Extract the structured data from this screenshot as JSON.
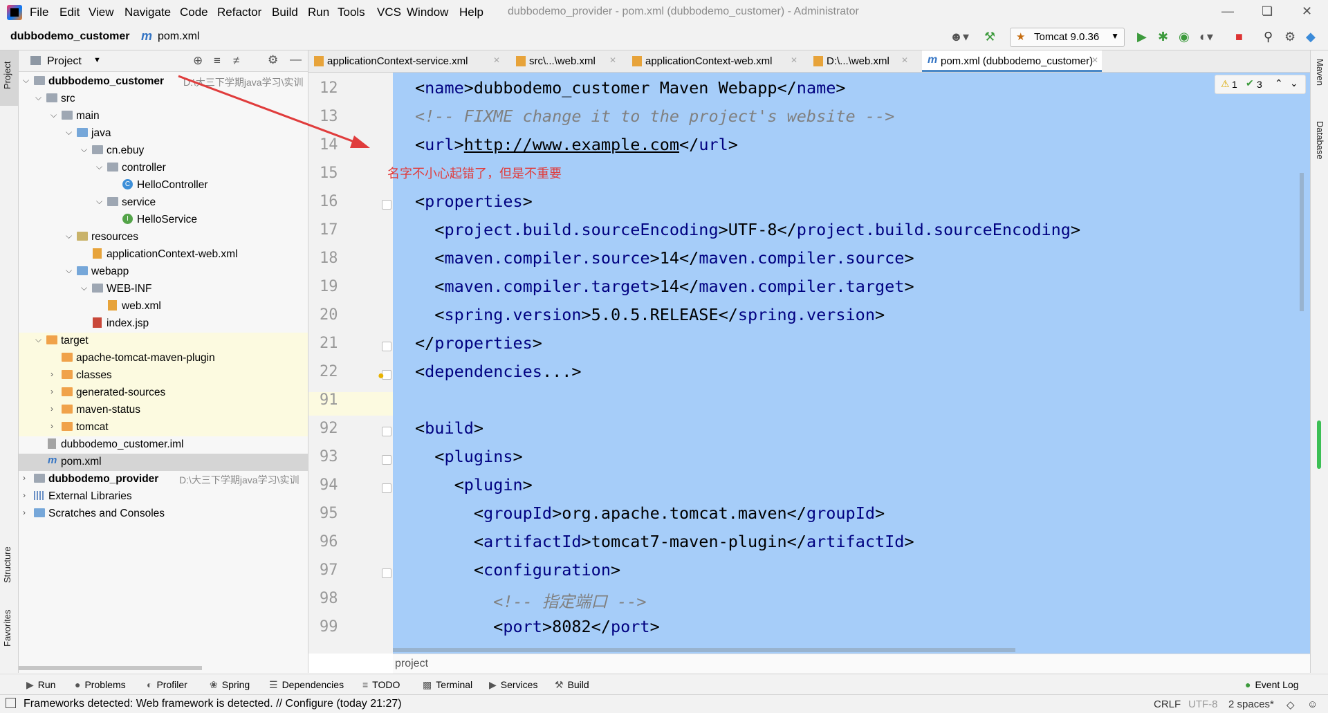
{
  "menubar": {
    "items": [
      "File",
      "Edit",
      "View",
      "Navigate",
      "Code",
      "Refactor",
      "Build",
      "Run",
      "Tools",
      "VCS",
      "Window",
      "Help"
    ],
    "window_title": "dubbodemo_provider - pom.xml (dubbodemo_customer) - Administrator"
  },
  "navbar": {
    "project": "dubbodemo_customer",
    "file_icon": "m",
    "file": "pom.xml",
    "run_config": "Tomcat 9.0.36"
  },
  "left_stripe": {
    "project": "Project",
    "structure": "Structure",
    "favorites": "Favorites"
  },
  "right_stripe": {
    "maven": "Maven",
    "database": "Database"
  },
  "project_panel": {
    "title": "Project",
    "tree": [
      {
        "label": "dubbodemo_customer",
        "path": "D:\\大三下学期java学习\\实训",
        "bold": true
      },
      {
        "label": "src"
      },
      {
        "label": "main"
      },
      {
        "label": "java"
      },
      {
        "label": "cn.ebuy"
      },
      {
        "label": "controller"
      },
      {
        "label": "HelloController"
      },
      {
        "label": "service"
      },
      {
        "label": "HelloService"
      },
      {
        "label": "resources"
      },
      {
        "label": "applicationContext-web.xml"
      },
      {
        "label": "webapp"
      },
      {
        "label": "WEB-INF"
      },
      {
        "label": "web.xml"
      },
      {
        "label": "index.jsp"
      },
      {
        "label": "target"
      },
      {
        "label": "apache-tomcat-maven-plugin"
      },
      {
        "label": "classes"
      },
      {
        "label": "generated-sources"
      },
      {
        "label": "maven-status"
      },
      {
        "label": "tomcat"
      },
      {
        "label": "dubbodemo_customer.iml"
      },
      {
        "label": "pom.xml"
      },
      {
        "label": "dubbodemo_provider",
        "path": "D:\\大三下学期java学习\\实训",
        "bold": true
      },
      {
        "label": "External Libraries"
      },
      {
        "label": "Scratches and Consoles"
      }
    ]
  },
  "tabs": [
    {
      "label": "applicationContext-service.xml"
    },
    {
      "label": "src\\...\\web.xml"
    },
    {
      "label": "applicationContext-web.xml"
    },
    {
      "label": "D:\\...\\web.xml"
    },
    {
      "label": "pom.xml (dubbodemo_customer)",
      "active": true
    }
  ],
  "inspection": {
    "warnings": "1",
    "checks": "3"
  },
  "annotation": "名字不小心起错了，但是不重要",
  "editor": {
    "line_numbers": [
      "12",
      "13",
      "14",
      "15",
      "16",
      "17",
      "18",
      "19",
      "20",
      "21",
      "22",
      "91",
      "92",
      "93",
      "94",
      "95",
      "96",
      "97",
      "98",
      "99"
    ],
    "code": [
      {
        "pre": "<",
        "tag": "name",
        "mid": ">dubbodemo_customer Maven Webapp</",
        "tag2": "name",
        "post": ">"
      },
      {
        "comment": "<!-- FIXME change it to the project's website -->"
      },
      {
        "pre": "<",
        "tag": "url",
        "mid": ">",
        "link": "http://www.example.com",
        "mid2": "</",
        "tag2": "url",
        "post": ">"
      },
      {},
      {
        "pre": "<",
        "tag": "properties",
        "post": ">"
      },
      {
        "pre": "  <",
        "tag": "project.build.sourceEncoding",
        "mid": ">UTF-8</",
        "tag2": "project.build.sourceEncoding",
        "post": ">"
      },
      {
        "pre": "  <",
        "tag": "maven.compiler.source",
        "mid": ">14</",
        "tag2": "maven.compiler.source",
        "post": ">"
      },
      {
        "pre": "  <",
        "tag": "maven.compiler.target",
        "mid": ">14</",
        "tag2": "maven.compiler.target",
        "post": ">"
      },
      {
        "pre": "  <",
        "tag": "spring.version",
        "mid": ">5.0.5.RELEASE</",
        "tag2": "spring.version",
        "post": ">"
      },
      {
        "pre": "</",
        "tag": "properties",
        "post": ">"
      },
      {
        "pre": "<",
        "tag": "dependencies",
        "post": "...>"
      },
      {},
      {
        "pre": "<",
        "tag": "build",
        "post": ">"
      },
      {
        "pre": "  <",
        "tag": "plugins",
        "post": ">"
      },
      {
        "pre": "    <",
        "tag": "plugin",
        "post": ">"
      },
      {
        "pre": "      <",
        "tag": "groupId",
        "mid": ">org.apache.tomcat.maven</",
        "tag2": "groupId",
        "post": ">"
      },
      {
        "pre": "      <",
        "tag": "artifactId",
        "mid": ">tomcat7-maven-plugin</",
        "tag2": "artifactId",
        "post": ">"
      },
      {
        "pre": "      <",
        "tag": "configuration",
        "post": ">"
      },
      {
        "comment": "        <!-- 指定端口 -->"
      },
      {
        "pre": "        <",
        "tag": "port",
        "mid": ">8082</",
        "tag2": "port",
        "post": ">"
      }
    ],
    "breadcrumb": "project"
  },
  "bottom_tools": [
    "Run",
    "Problems",
    "Profiler",
    "Spring",
    "Dependencies",
    "TODO",
    "Terminal",
    "Services",
    "Build",
    "Event Log"
  ],
  "status": {
    "message": "Frameworks detected: Web framework is detected. // Configure (today 21:27)",
    "line_sep": "CRLF",
    "encoding": "UTF-8",
    "indent": "2 spaces*"
  }
}
